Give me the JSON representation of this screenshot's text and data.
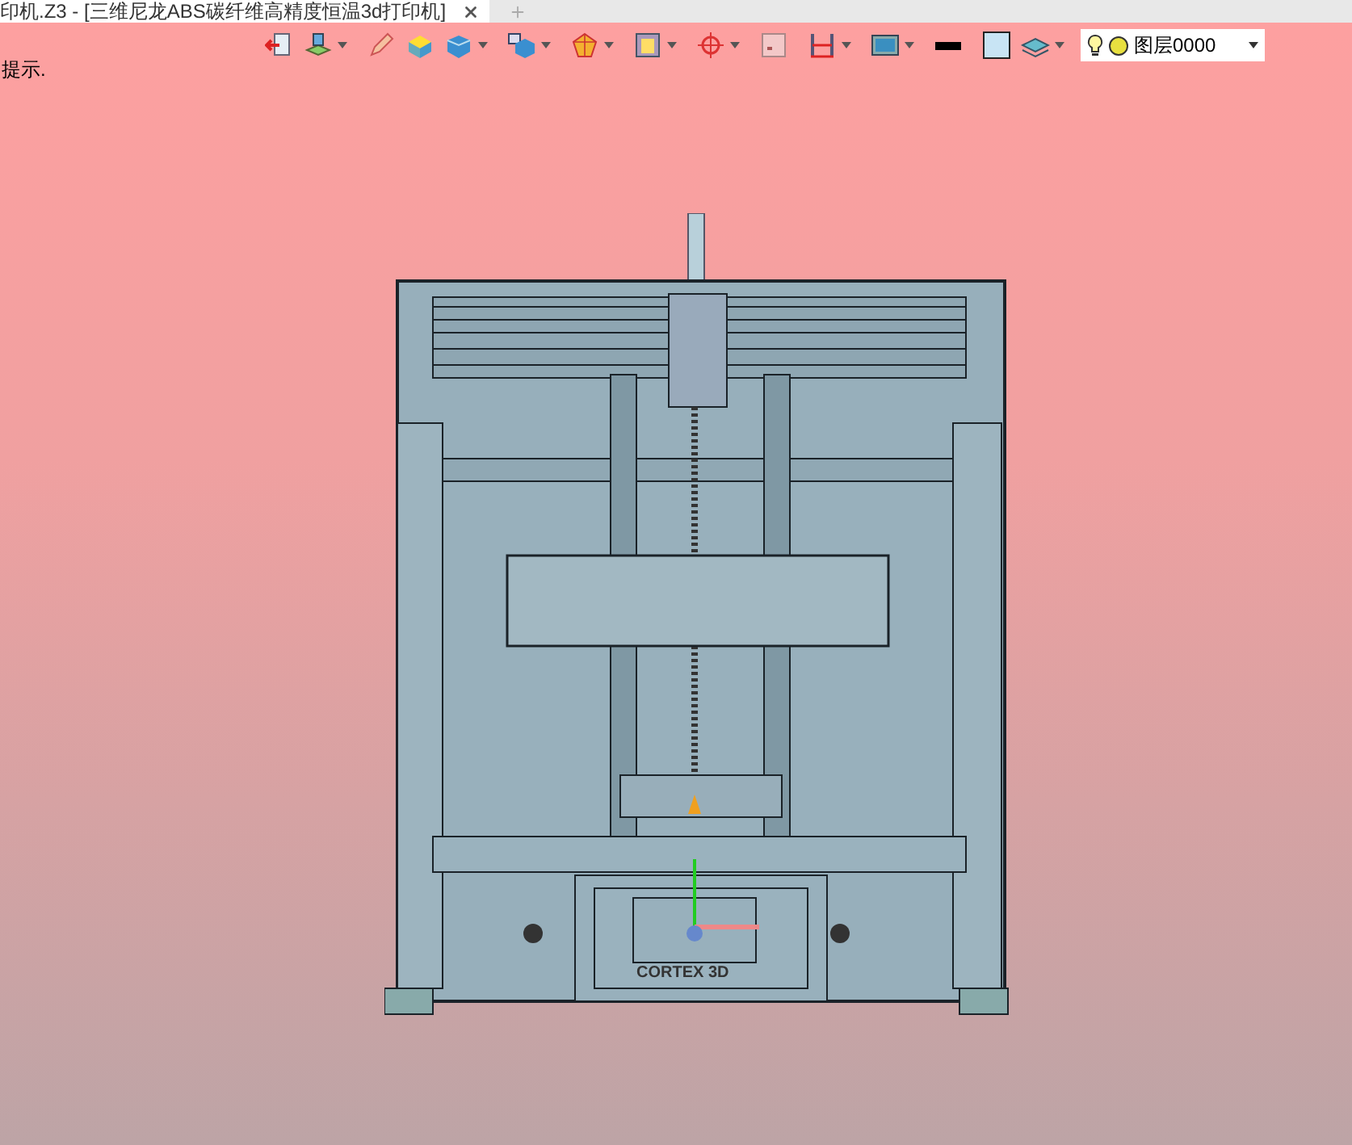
{
  "tab": {
    "title": "印机.Z3 - [三维尼龙ABS碳纤维高精度恒温3d打印机]"
  },
  "layer_select": {
    "value": "图层0000"
  },
  "hint": "提示.",
  "model": {
    "label": "CORTEX 3D"
  }
}
